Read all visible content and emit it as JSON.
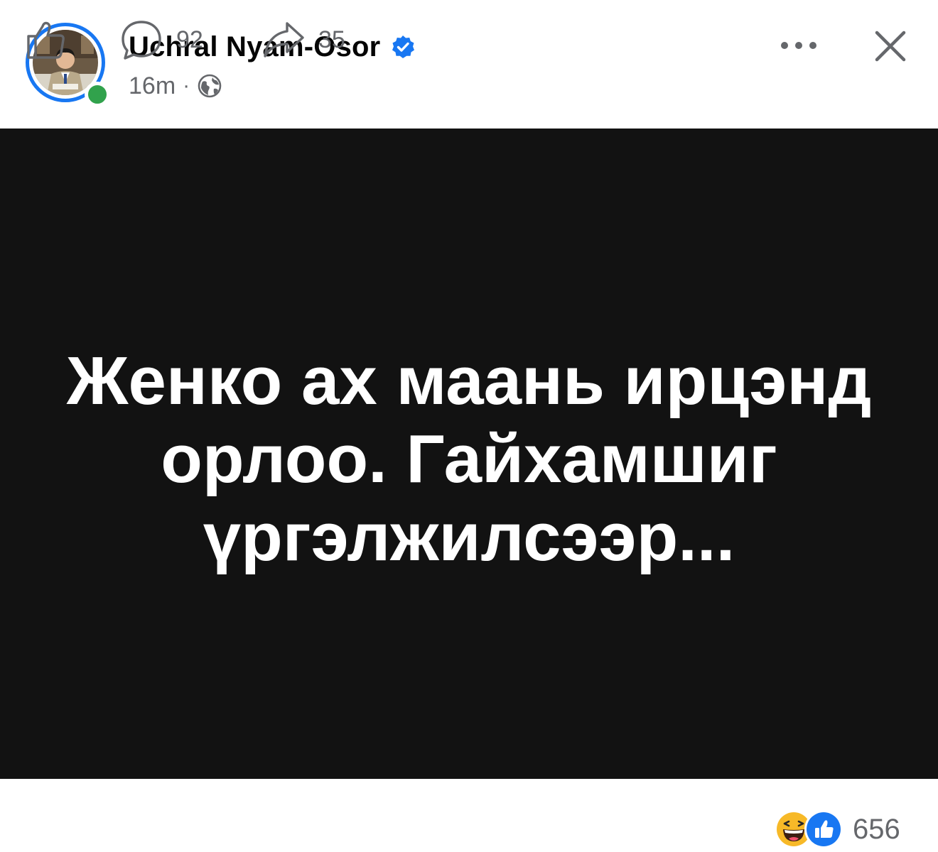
{
  "post": {
    "author": "Uchral Nyam-Osor",
    "verified": true,
    "timestamp": "16m",
    "separator": "·",
    "privacy_icon": "globe-icon",
    "body_text": "Женко ах маань ирцэнд орлоо. Гайхамшиг үргэлжилсээр...",
    "body_background": "#121212",
    "body_text_color": "#ffffff"
  },
  "header": {
    "more_icon": "ellipsis-icon",
    "close_icon": "close-icon"
  },
  "actions": {
    "like_icon": "thumbs-up-icon",
    "comment_icon": "comment-icon",
    "comment_count": "92",
    "share_icon": "share-icon",
    "share_count": "35"
  },
  "reactions": {
    "icons": [
      "haha-reaction-icon",
      "like-reaction-icon"
    ],
    "count": "656"
  },
  "colors": {
    "accent": "#1877f2",
    "online": "#31a24c",
    "secondary_text": "#65676b",
    "haha": "#f7b928"
  }
}
